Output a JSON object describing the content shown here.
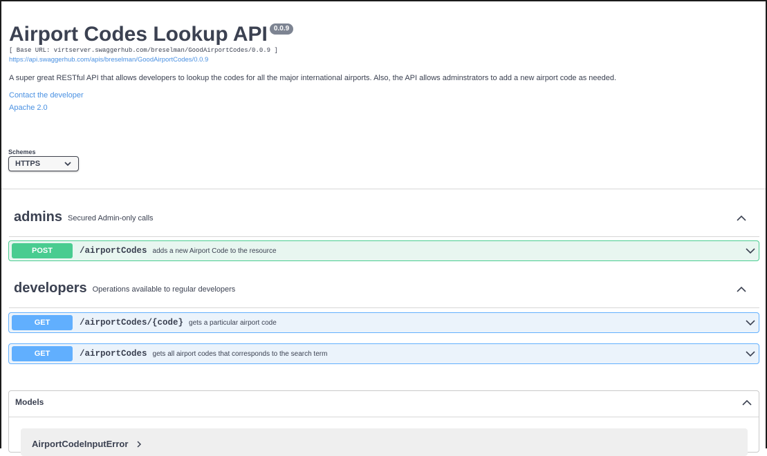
{
  "info": {
    "title": "Airport Codes Lookup API",
    "version": "0.0.9",
    "base_url": "[ Base URL: virtserver.swaggerhub.com/breselman/GoodAirportCodes/0.0.9 ]",
    "api_url": "https://api.swaggerhub.com/apis/breselman/GoodAirportCodes/0.0.9",
    "description": "A super great RESTful API that allows developers to lookup the codes for all the major international airports. Also, the API allows adminstrators to add a new airport code as needed.",
    "contact_label": "Contact the developer",
    "license_label": "Apache 2.0"
  },
  "schemes": {
    "label": "Schemes",
    "selected": "HTTPS"
  },
  "tags": [
    {
      "name": "admins",
      "description": "Secured Admin-only calls",
      "operations": [
        {
          "method": "POST",
          "path": "/airportCodes",
          "summary": "adds a new Airport Code to the resource"
        }
      ]
    },
    {
      "name": "developers",
      "description": "Operations available to regular developers",
      "operations": [
        {
          "method": "GET",
          "path": "/airportCodes/{code}",
          "summary": "gets a particular airport code"
        },
        {
          "method": "GET",
          "path": "/airportCodes",
          "summary": "gets all airport codes that corresponds to the search term"
        }
      ]
    }
  ],
  "models": {
    "title": "Models",
    "items": [
      {
        "name": "AirportCodeInputError"
      }
    ]
  },
  "colors": {
    "post": "#49cc90",
    "get": "#61affe",
    "link": "#4990e2",
    "text": "#3b4151"
  },
  "icons": {
    "collapse": "chevron-up-icon",
    "expand": "chevron-down-icon",
    "model_expand": "chevron-right-icon"
  }
}
